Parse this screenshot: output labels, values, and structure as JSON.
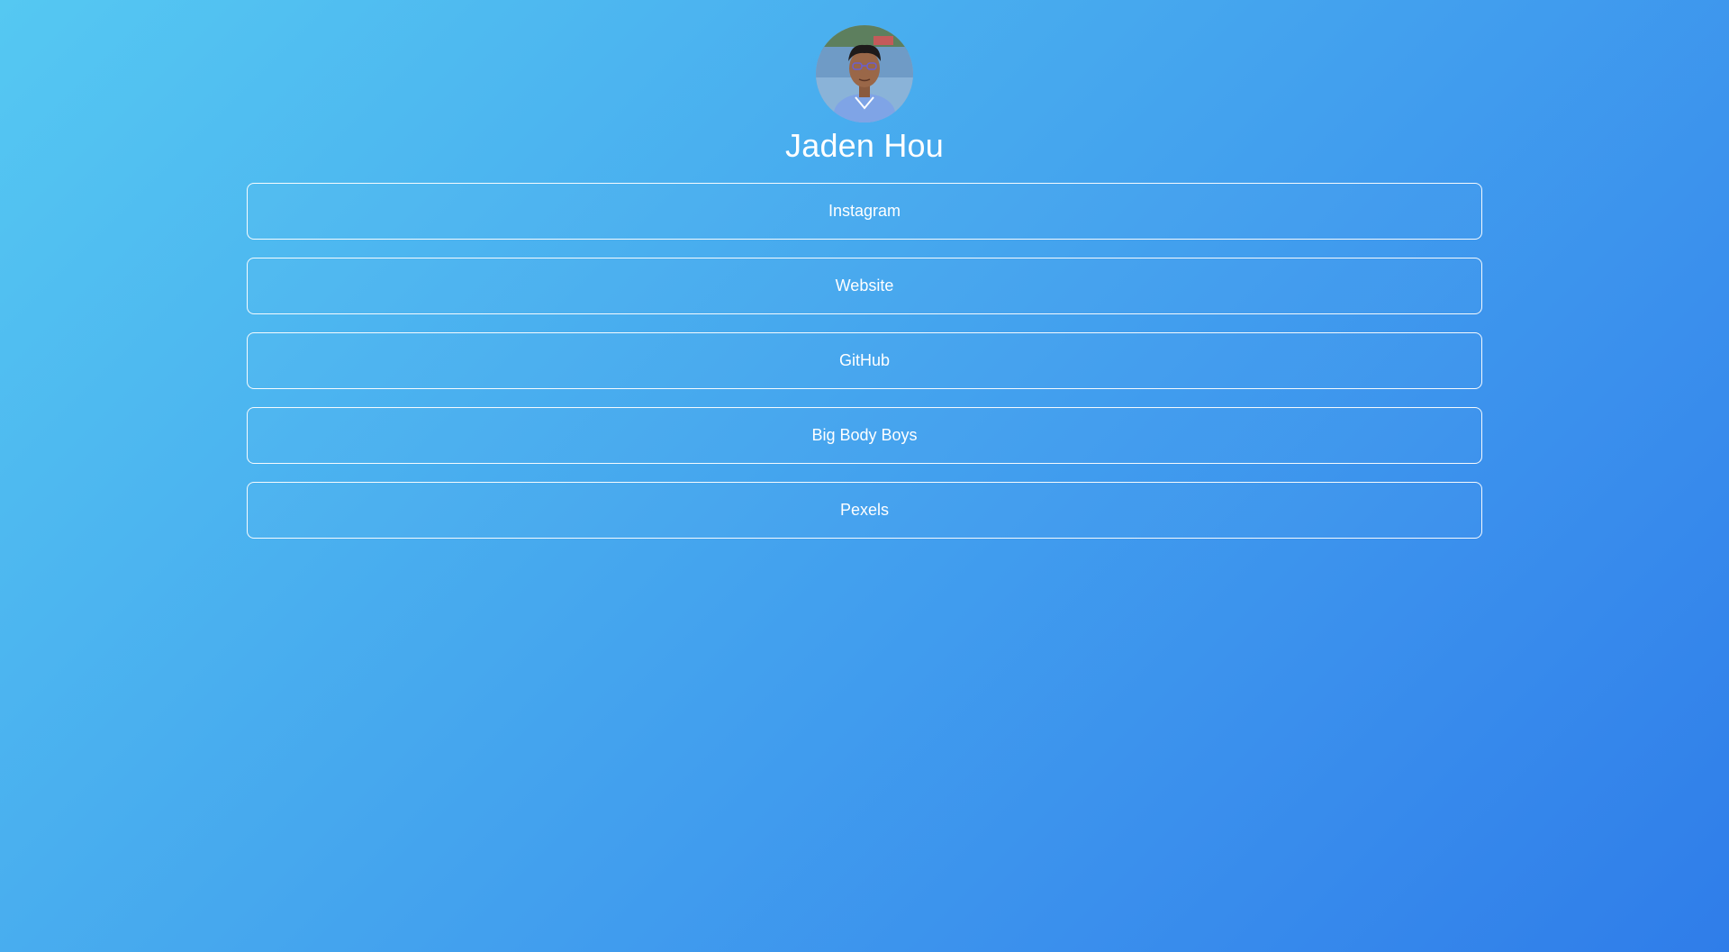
{
  "profile": {
    "name": "Jaden Hou"
  },
  "links": [
    {
      "label": "Instagram"
    },
    {
      "label": "Website"
    },
    {
      "label": "GitHub"
    },
    {
      "label": "Big Body Boys"
    },
    {
      "label": "Pexels"
    }
  ],
  "colors": {
    "background_start": "#55c8f2",
    "background_end": "#2f7de9",
    "text": "#ffffff",
    "button_border": "#ffffff"
  }
}
